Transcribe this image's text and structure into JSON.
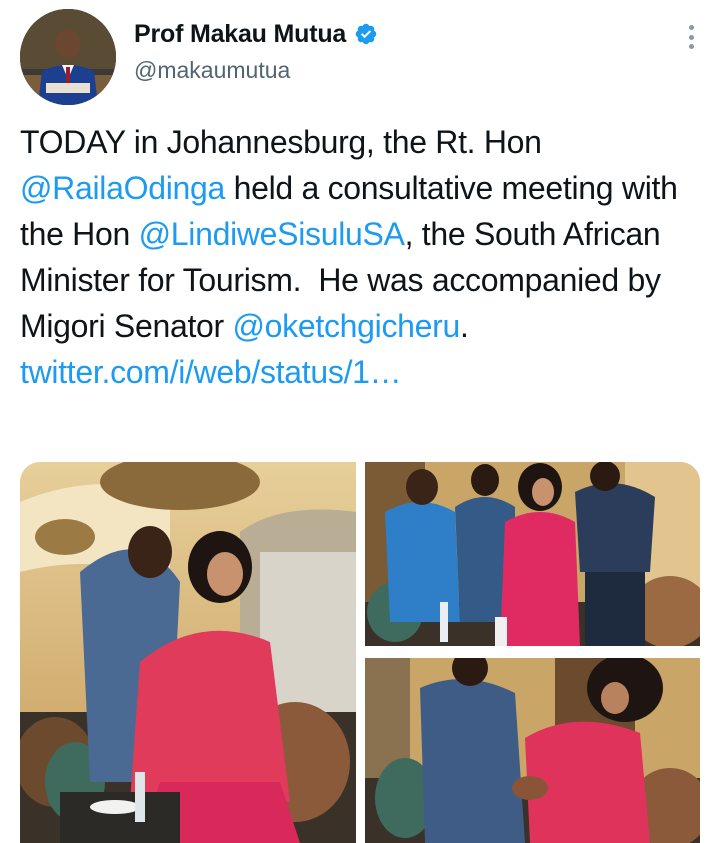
{
  "author": {
    "display_name": "Prof Makau Mutua",
    "handle": "@makaumutua",
    "verified": true
  },
  "tweet": {
    "segments": [
      {
        "text": "TODAY in Johannesburg, the Rt. Hon ",
        "type": "text"
      },
      {
        "text": "@RailaOdinga",
        "type": "mention"
      },
      {
        "text": " held a consultative meeting with the Hon ",
        "type": "text"
      },
      {
        "text": "@LindiweSisuluSA",
        "type": "mention"
      },
      {
        "text": ", the South African Minister for Tourism.  He was accompanied by Migori Senator ",
        "type": "text"
      },
      {
        "text": "@oketchgicheru",
        "type": "mention"
      },
      {
        "text": ". ",
        "type": "text"
      },
      {
        "text": "twitter.com/i/web/status/1…",
        "type": "link"
      }
    ]
  },
  "colors": {
    "link": "#1d9bf0",
    "verified_badge": "#1d9bf0",
    "secondary_text": "#536471"
  },
  "icons": {
    "verified": "verified-badge-icon",
    "more": "more-options-icon"
  },
  "media": [
    {
      "photo": "photo-1",
      "position": "left-full"
    },
    {
      "photo": "photo-2",
      "position": "top-right"
    },
    {
      "photo": "photo-3",
      "position": "bottom-right"
    }
  ]
}
